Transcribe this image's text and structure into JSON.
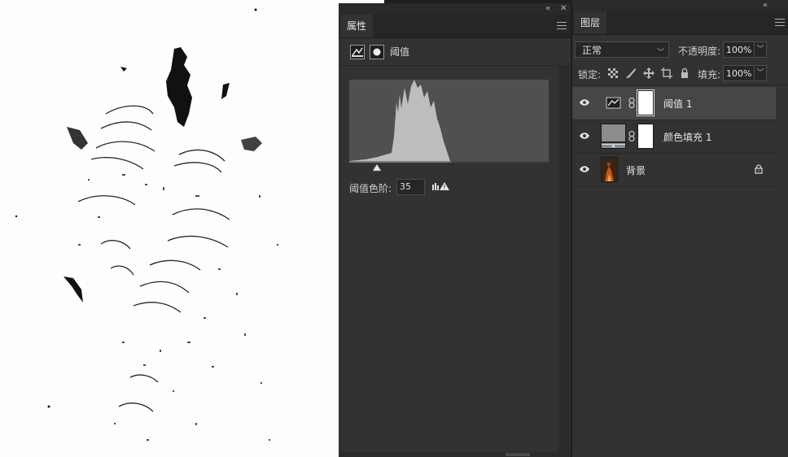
{
  "properties_panel": {
    "tab_label": "属性",
    "header_title": "阈值",
    "threshold_label": "阈值色阶:",
    "threshold_value": "35",
    "threshold_level": 35
  },
  "layers_panel": {
    "tab_label": "图层",
    "blend_mode": "正常",
    "opacity_label": "不透明度:",
    "opacity_value": "100%",
    "lock_label": "锁定:",
    "fill_label": "填充:",
    "fill_value": "100%",
    "layers": [
      {
        "name": "阈值 1",
        "type": "adjustment",
        "selected": true,
        "visible": true
      },
      {
        "name": "颜色填充 1",
        "type": "fill",
        "selected": false,
        "visible": true
      },
      {
        "name": "背景",
        "type": "background",
        "selected": false,
        "visible": true,
        "locked": true
      }
    ]
  },
  "icons": [
    "collapse-icon",
    "close-icon",
    "panel-menu-icon",
    "threshold-adjustment-icon",
    "mask-icon",
    "warning-icon",
    "eye-icon",
    "link-icon",
    "lock-icon",
    "lock-transparent-icon",
    "brush-icon",
    "move-icon",
    "artboard-icon"
  ],
  "colors": {
    "panel_bg": "#323232",
    "panel_dark": "#262626",
    "histogram_fill": "#bdbdbd",
    "selected_row": "#464646"
  }
}
